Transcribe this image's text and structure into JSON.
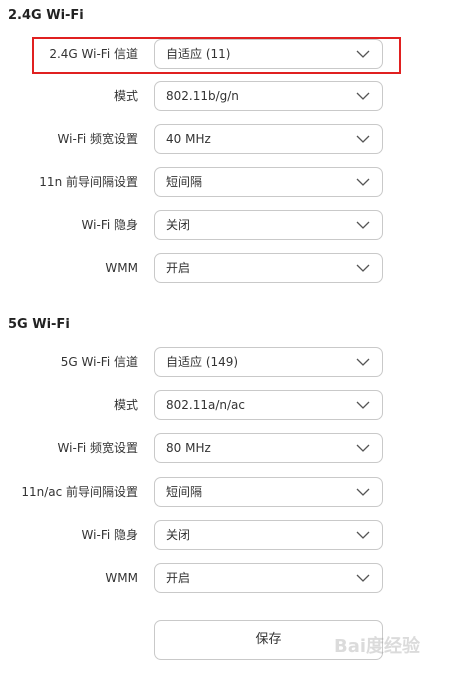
{
  "section_24g": {
    "title": "2.4G Wi-Fi",
    "rows": [
      {
        "label": "2.4G Wi-Fi 信道",
        "value": "自适应 (11)"
      },
      {
        "label": "模式",
        "value": "802.11b/g/n"
      },
      {
        "label": "Wi-Fi 频宽设置",
        "value": "40 MHz"
      },
      {
        "label": "11n 前导间隔设置",
        "value": "短间隔"
      },
      {
        "label": "Wi-Fi 隐身",
        "value": "关闭"
      },
      {
        "label": "WMM",
        "value": "开启"
      }
    ]
  },
  "section_5g": {
    "title": "5G Wi-Fi",
    "rows": [
      {
        "label": "5G Wi-Fi 信道",
        "value": "自适应 (149)"
      },
      {
        "label": "模式",
        "value": "802.11a/n/ac"
      },
      {
        "label": "Wi-Fi 频宽设置",
        "value": "80 MHz"
      },
      {
        "label": "11n/ac 前导间隔设置",
        "value": "短间隔"
      },
      {
        "label": "Wi-Fi 隐身",
        "value": "关闭"
      },
      {
        "label": "WMM",
        "value": "开启"
      }
    ]
  },
  "save_label": "保存",
  "watermark": "Bai度经验",
  "colors": {
    "highlight": "#e02020",
    "border": "#c9c9c9",
    "text": "#333333"
  }
}
